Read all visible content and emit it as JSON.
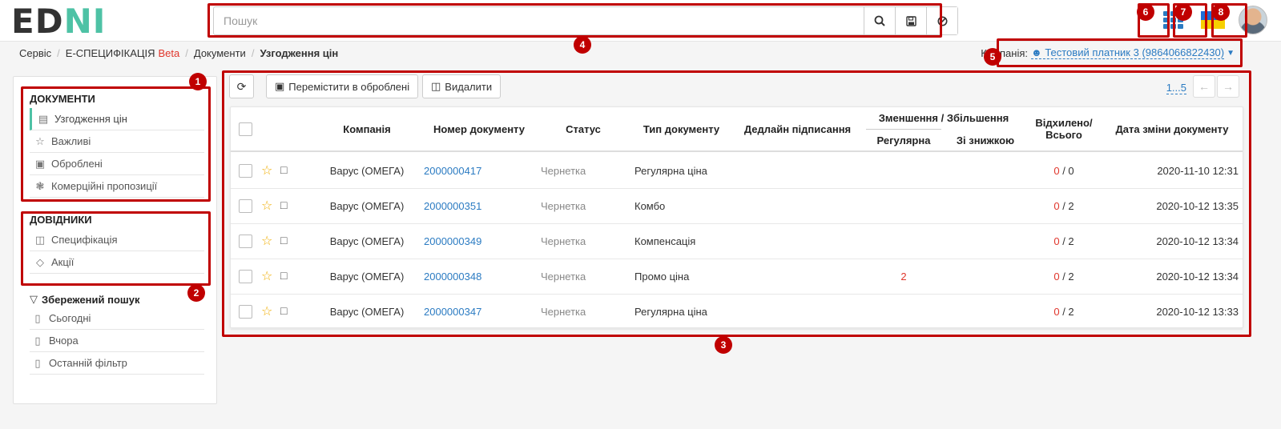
{
  "app": {
    "logo_left": "ED",
    "logo_right": "NI"
  },
  "search": {
    "placeholder": "Пошук",
    "value": ""
  },
  "breadcrumb": {
    "items": [
      "Сервіс",
      "Е-СПЕЦИФІКАЦІЯ",
      "Документи"
    ],
    "beta": "Beta",
    "current": "Узгодження цін"
  },
  "company": {
    "label": "Компанія:",
    "value": "Тестовий платник 3 (9864066822430)"
  },
  "sidebar": {
    "documents_title": "ДОКУМЕНТИ",
    "documents": [
      {
        "label": "Узгодження цін",
        "icon": "ledger-icon"
      },
      {
        "label": "Важливі",
        "icon": "star-icon"
      },
      {
        "label": "Оброблені",
        "icon": "archive-icon"
      },
      {
        "label": "Комерційні пропозиції",
        "icon": "badge-icon"
      }
    ],
    "references_title": "ДОВІДНИКИ",
    "references": [
      {
        "label": "Специфікація",
        "icon": "boxes-icon"
      },
      {
        "label": "Акції",
        "icon": "tags-icon"
      }
    ],
    "saved_title": "Збережений пошук",
    "saved": [
      {
        "label": "Сьогодні"
      },
      {
        "label": "Вчора"
      },
      {
        "label": "Останній фільтр"
      }
    ]
  },
  "toolbar": {
    "move_label": "Перемістити в оброблені",
    "delete_label": "Видалити",
    "pager": "1...5"
  },
  "table": {
    "headers": {
      "company": "Компанія",
      "doc_number": "Номер документу",
      "status": "Статус",
      "doc_type": "Тип документу",
      "deadline": "Дедлайн підписання",
      "change_group": "Зменшення / Збільшення",
      "regular": "Регулярна",
      "discount": "Зі знижкою",
      "rejected_line1": "Відхилено/",
      "rejected_line2": "Всього",
      "changed_date": "Дата зміни документу"
    },
    "rows": [
      {
        "company": "Варус (ОМЕГА)",
        "number": "2000000417",
        "status": "Чернетка",
        "type": "Регулярна ціна",
        "regular": "",
        "rejected": "0",
        "total": " / 0",
        "date": "2020-11-10 12:31"
      },
      {
        "company": "Варус (ОМЕГА)",
        "number": "2000000351",
        "status": "Чернетка",
        "type": "Комбо",
        "regular": "",
        "rejected": "0",
        "total": " / 2",
        "date": "2020-10-12 13:35"
      },
      {
        "company": "Варус (ОМЕГА)",
        "number": "2000000349",
        "status": "Чернетка",
        "type": "Компенсація",
        "regular": "",
        "rejected": "0",
        "total": " / 2",
        "date": "2020-10-12 13:34"
      },
      {
        "company": "Варус (ОМЕГА)",
        "number": "2000000348",
        "status": "Чернетка",
        "type": "Промо ціна",
        "regular": "2",
        "rejected": "0",
        "total": " / 2",
        "date": "2020-10-12 13:34"
      },
      {
        "company": "Варус (ОМЕГА)",
        "number": "2000000347",
        "status": "Чернетка",
        "type": "Регулярна ціна",
        "regular": "",
        "rejected": "0",
        "total": " / 2",
        "date": "2020-10-12 13:33"
      }
    ]
  },
  "annotations": [
    "1",
    "2",
    "3",
    "4",
    "5",
    "6",
    "7",
    "8"
  ],
  "colors": {
    "accent": "#4ec2a5",
    "link": "#2b7bc2",
    "annotation": "#c00000",
    "danger": "#e0352b"
  }
}
